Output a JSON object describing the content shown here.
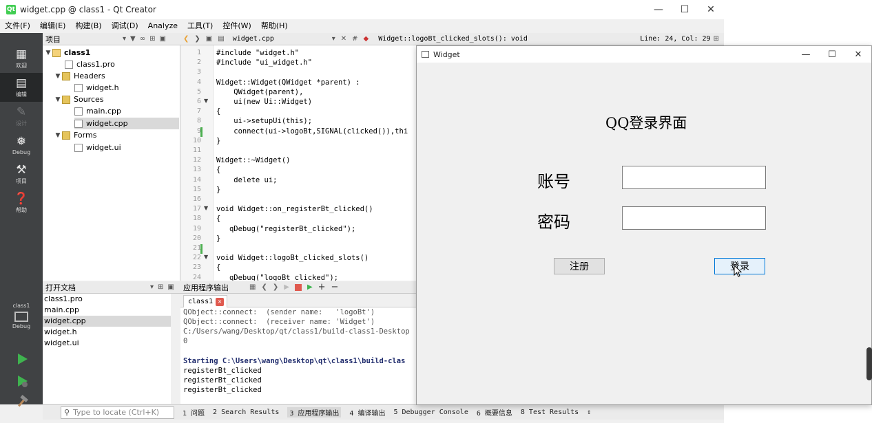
{
  "creator": {
    "title": "widget.cpp @ class1 - Qt Creator",
    "app_icon_text": "Qt",
    "menu": [
      "文件(F)",
      "编辑(E)",
      "构建(B)",
      "调试(D)",
      "Analyze",
      "工具(T)",
      "控件(W)",
      "帮助(H)"
    ],
    "modes": [
      "欢迎",
      "编辑",
      "设计",
      "Debug",
      "项目",
      "帮助"
    ],
    "kit": {
      "name": "class1",
      "mode": "Debug"
    },
    "project_pane": {
      "title": "项目",
      "nodes": [
        "class1",
        "class1.pro",
        "Headers",
        "widget.h",
        "Sources",
        "main.cpp",
        "widget.cpp",
        "Forms",
        "widget.ui"
      ]
    },
    "open_docs": {
      "title": "打开文档",
      "items": [
        "class1.pro",
        "main.cpp",
        "widget.cpp",
        "widget.h",
        "widget.ui"
      ],
      "selected": "widget.cpp"
    },
    "editor": {
      "file": "widget.cpp",
      "symbol": "Widget::logoBt_clicked_slots(): void",
      "position": "Line: 24, Col: 29",
      "hash_label": "#",
      "line_numbers": [
        "1",
        "2",
        "3",
        "4",
        "5",
        "6",
        "7",
        "8",
        "9",
        "10",
        "11",
        "12",
        "13",
        "14",
        "15",
        "16",
        "17",
        "18",
        "19",
        "20",
        "21",
        "22",
        "23",
        "24"
      ],
      "lines": [
        "#include \"widget.h\"",
        "#include \"ui_widget.h\"",
        "",
        "Widget::Widget(QWidget *parent) :",
        "    QWidget(parent),",
        "    ui(new Ui::Widget)",
        "{",
        "    ui->setupUi(this);",
        "    connect(ui->logoBt,SIGNAL(clicked()),thi",
        "}",
        "",
        "Widget::~Widget()",
        "{",
        "    delete ui;",
        "}",
        "",
        "void Widget::on_registerBt_clicked()",
        "{",
        "   qDebug(\"registerBt_clicked\");",
        "}",
        "",
        "void Widget::logoBt_clicked_slots()",
        "{",
        "   qDebug(\"logoBt_clicked\");"
      ]
    },
    "output": {
      "title": "应用程序输出",
      "tab": "class1",
      "lines": [
        "QObject::connect:  (sender name:   'logoBt')",
        "QObject::connect:  (receiver name: 'Widget')",
        "C:/Users/wang/Desktop/qt/class1/build-class1-Desktop",
        "0",
        "",
        "Starting C:\\Users\\wang\\Desktop\\qt\\class1\\build-clas",
        "registerBt_clicked",
        "registerBt_clicked",
        "registerBt_clicked"
      ]
    },
    "status": {
      "locator_placeholder": "Type to locate (Ctrl+K)",
      "tabs": [
        "1 问题",
        "2 Search Results",
        "3 应用程序输出",
        "4 编译输出",
        "5 Debugger Console",
        "6 概要信息",
        "8 Test Results"
      ],
      "active_tab": "3 应用程序输出"
    }
  },
  "widget_window": {
    "title": "Widget",
    "heading": "QQ登录界面",
    "account_label": "账号",
    "password_label": "密码",
    "account_value": "",
    "password_value": "",
    "register_button": "注册",
    "login_button": "登录"
  },
  "colors": {
    "mode_bar": "#404244",
    "accent": "#0078d7",
    "stop": "#e05a4f"
  }
}
